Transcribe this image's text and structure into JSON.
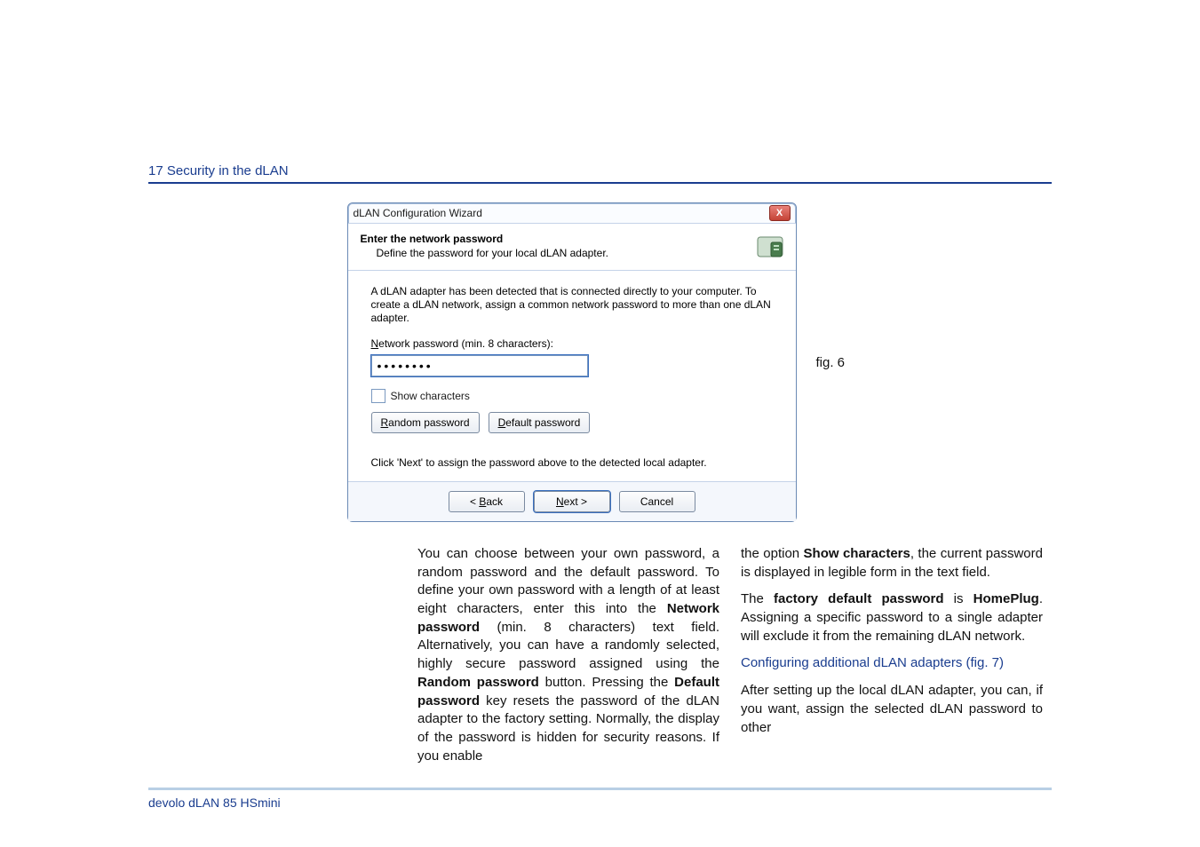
{
  "header": "17 Security in the dLAN",
  "dialog": {
    "window_title": "dLAN Configuration Wizard",
    "close_glyph": "X",
    "title_strong": "Enter the network password",
    "title_sub": "Define the password for your local dLAN adapter.",
    "paragraph": "A dLAN adapter has been detected that is connected directly to your computer. To create a dLAN network, assign a common network password to more than one dLAN adapter.",
    "pwd_label_pre": "N",
    "pwd_label_rest": "etwork password (min. 8 characters):",
    "pwd_value": "••••••••",
    "show_chars_pre": "S",
    "show_chars_rest": "how characters",
    "random_pre": "R",
    "random_rest": "andom password",
    "default_pre": "D",
    "default_rest": "efault password",
    "hint": "Click 'Next' to assign the password above to the detected local adapter.",
    "back_pre": "< ",
    "back_u": "B",
    "back_rest": "ack",
    "next_u": "N",
    "next_rest": "ext >",
    "cancel": "Cancel"
  },
  "fig_label": "fig. 6",
  "body": {
    "left": "You can choose between your own password, a random password and the default password. To define your own password with a length of at least eight characters, enter this into the <b>Network password</b> (min. 8 characters) text field. Alternatively, you can have a randomly selected, highly secure password assigned using the <b>Random password</b> button. Pressing the <b>Default password</b> key resets the password of the dLAN adapter to the factory setting. Normally, the display of the password is hidden for security reasons. If you enable",
    "right1": "the option <b>Show characters</b>, the current password is displayed in legible form in the text field.",
    "right2": "The <b>factory default password</b> is <b>HomePlug</b>. Assigning a specific password to a single adapter will exclude it from the remaining dLAN network.",
    "subhead": "Configuring additional dLAN adapters (fig. 7)",
    "right3": "After setting up the local dLAN adapter, you can, if you want, assign the selected dLAN password to other"
  },
  "footer": "devolo dLAN 85 HSmini"
}
